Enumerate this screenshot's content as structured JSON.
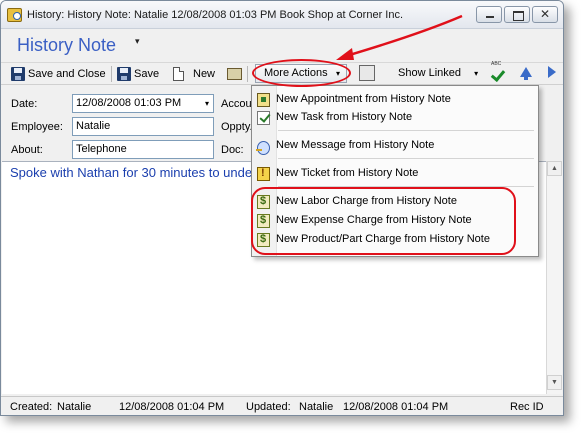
{
  "window": {
    "title": "History: History Note: Natalie 12/08/2008  01:03 PM Book Shop at Corner Inc.",
    "close_glyph": "✕"
  },
  "header": {
    "form_title": "History Note",
    "caret": "▾"
  },
  "toolbar": {
    "save_close_label": "Save and Close",
    "save_label": "Save",
    "new_label": "New",
    "more_actions_label": "More Actions",
    "show_linked_label": "Show Linked",
    "dropdown_glyph": "▾"
  },
  "fields": {
    "date_label": "Date:",
    "date_value": "12/08/2008   01:03 PM",
    "employee_label": "Employee:",
    "employee_value": "Natalie",
    "about_label": "About:",
    "about_value": "Telephone",
    "account_label": "Accou",
    "oppty_label": "Oppty.",
    "doc_label": "Doc:"
  },
  "notes": {
    "text": "Spoke with Nathan for 30 minutes to unde"
  },
  "status": {
    "created_label": "Created:",
    "created_by": "Natalie",
    "created_at": "12/08/2008  01:04 PM",
    "updated_label": "Updated:",
    "updated_by": "Natalie",
    "updated_at": "12/08/2008  01:04 PM",
    "rec_id_label": "Rec ID"
  },
  "menu": {
    "items": [
      {
        "label": "New Appointment from History Note",
        "icon": "appointment-icon"
      },
      {
        "label": "New Task from History Note",
        "icon": "task-icon"
      },
      {
        "label": "New Message from History Note",
        "icon": "message-icon"
      },
      {
        "label": "New Ticket from History Note",
        "icon": "ticket-icon"
      },
      {
        "label": "New Labor Charge from History Note",
        "icon": "charge-icon"
      },
      {
        "label": "New Expense Charge from History Note",
        "icon": "charge-icon"
      },
      {
        "label": "New Product/Part Charge from History Note",
        "icon": "charge-icon"
      }
    ]
  },
  "colors": {
    "accent": "#3a5fc4",
    "annotation": "#e0101a",
    "notes_text": "#1b3fae"
  }
}
